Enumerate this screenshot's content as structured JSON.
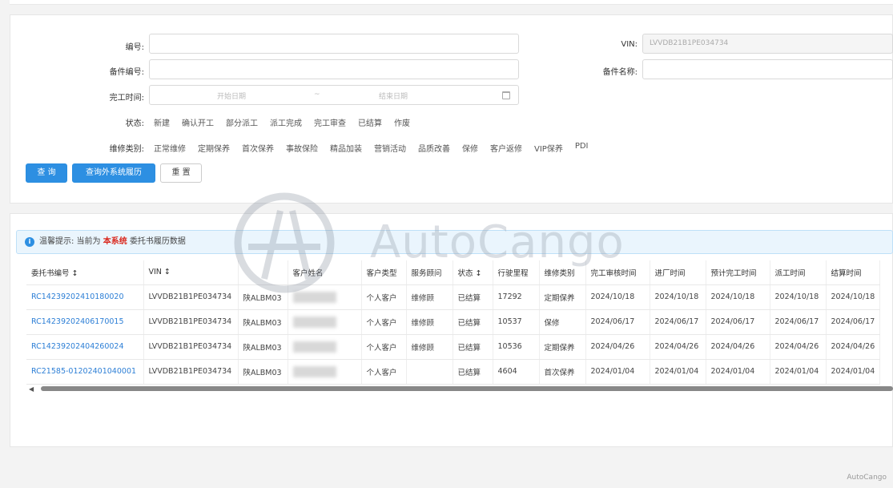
{
  "form": {
    "fields": {
      "code_label": "编号:",
      "vin_label": "VIN:",
      "vin_value": "LVVDB21B1PE034734",
      "part_code_label": "备件编号:",
      "part_name_label": "备件名称:",
      "finish_time_label": "完工时间:",
      "date_start_placeholder": "开始日期",
      "date_sep": "~",
      "date_end_placeholder": "结束日期"
    },
    "status_label": "状态:",
    "status_options": [
      "新建",
      "确认开工",
      "部分派工",
      "派工完成",
      "完工审查",
      "已结算",
      "作废"
    ],
    "repair_type_label": "维修类别:",
    "repair_type_options": [
      "正常维修",
      "定期保养",
      "首次保养",
      "事故保险",
      "精品加装",
      "营销活动",
      "品质改善",
      "保修",
      "客户返修",
      "VIP保养",
      "PDI"
    ],
    "buttons": {
      "query": "查 询",
      "query_external": "查询外系统履历",
      "reset": "重 置"
    }
  },
  "alert": {
    "prefix": "温馨提示: 当前为",
    "highlight": "本系统",
    "suffix": "委托书履历数据"
  },
  "table": {
    "headers": [
      "委托书编号 ↕",
      "VIN ↕",
      "",
      "客户姓名",
      "客户类型",
      "服务顾问",
      "状态 ↕",
      "行驶里程",
      "维修类别",
      "完工审核时间",
      "进厂时间",
      "预计完工时间",
      "派工时间",
      "结算时间"
    ],
    "rows": [
      [
        "RC14239202410180020",
        "LVVDB21B1PE034734",
        "陕ALBM03",
        "",
        "个人客户",
        "维修顾",
        "已结算",
        "17292",
        "定期保养",
        "2024/10/18",
        "2024/10/18",
        "2024/10/18",
        "2024/10/18",
        "2024/10/18"
      ],
      [
        "RC14239202406170015",
        "LVVDB21B1PE034734",
        "陕ALBM03",
        "",
        "个人客户",
        "维修顾",
        "已结算",
        "10537",
        "保修",
        "2024/06/17",
        "2024/06/17",
        "2024/06/17",
        "2024/06/17",
        "2024/06/17"
      ],
      [
        "RC14239202404260024",
        "LVVDB21B1PE034734",
        "陕ALBM03",
        "",
        "个人客户",
        "维修顾",
        "已结算",
        "10536",
        "定期保养",
        "2024/04/26",
        "2024/04/26",
        "2024/04/26",
        "2024/04/26",
        "2024/04/26"
      ],
      [
        "RC21585-01202401040001",
        "LVVDB21B1PE034734",
        "陕ALBM03",
        "",
        "个人客户",
        "",
        "已结算",
        "4604",
        "首次保养",
        "2024/01/04",
        "2024/01/04",
        "2024/01/04",
        "2024/01/04",
        "2024/01/04"
      ]
    ]
  },
  "watermark": {
    "text": "AutoCango",
    "corner_text": "AutoCango"
  },
  "colors": {
    "primary": "#2d8fe2",
    "link": "#2d7fd6",
    "highlight": "#d9281e"
  }
}
